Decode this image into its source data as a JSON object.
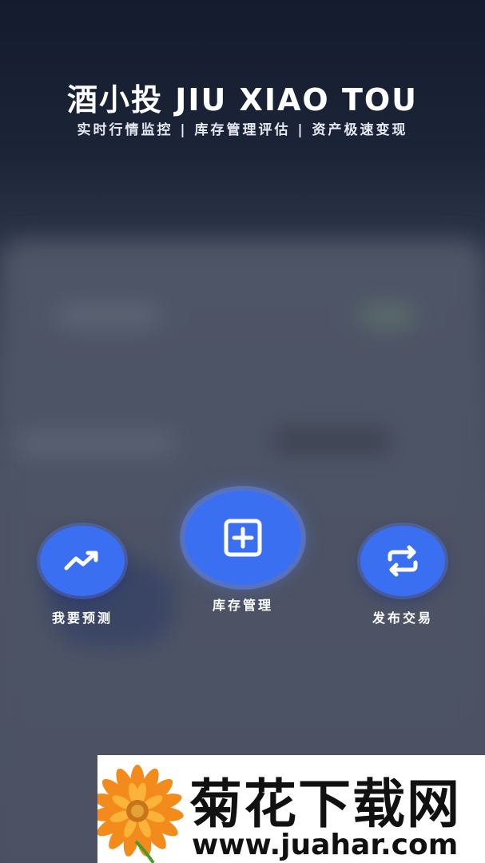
{
  "header": {
    "title": "酒小投 JIU XIAO TOU",
    "subtitle": "实时行情监控 | 库存管理评估 | 资产极速变现"
  },
  "actions": [
    {
      "label": "我要预测",
      "icon": "trend-up-icon"
    },
    {
      "label": "库存管理",
      "icon": "plus-square-icon"
    },
    {
      "label": "发布交易",
      "icon": "swap-arrows-icon"
    }
  ],
  "watermark": {
    "title": "菊花下载网",
    "url": "www.juahar.com"
  },
  "colors": {
    "accent": "#3b6ff2",
    "header_bg": "#141b2e",
    "overlay": "#4c5263"
  }
}
